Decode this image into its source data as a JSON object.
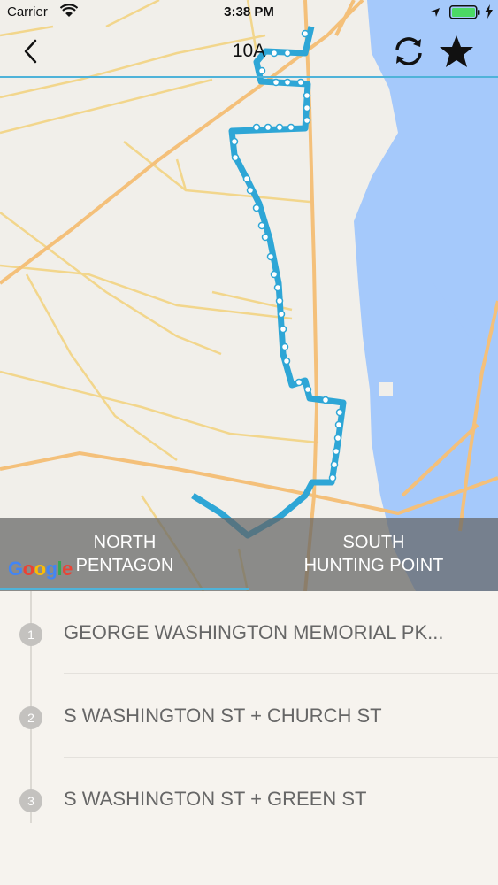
{
  "status_bar": {
    "carrier": "Carrier",
    "time": "3:38 PM"
  },
  "nav": {
    "title": "10A",
    "back_icon": "chevron-left-icon",
    "refresh_icon": "refresh-icon",
    "favorite_icon": "star-icon"
  },
  "directions": {
    "north": {
      "line1": "NORTH",
      "line2": "PENTAGON"
    },
    "south": {
      "line1": "SOUTH",
      "line2": "HUNTING POINT"
    },
    "selected": "north"
  },
  "map": {
    "attribution": "Google",
    "route_color": "#2ea6d6",
    "water_color": "#a5c9fb",
    "road_color": "#f2d68c",
    "highway_color": "#f4c07a"
  },
  "stops": [
    {
      "number": "1",
      "name": "GEORGE WASHINGTON MEMORIAL PK..."
    },
    {
      "number": "2",
      "name": "S WASHINGTON ST + CHURCH ST"
    },
    {
      "number": "3",
      "name": "S WASHINGTON ST + GREEN ST"
    }
  ],
  "colors": {
    "accent": "#4fb3d9",
    "tab_overlay": "#646464"
  }
}
